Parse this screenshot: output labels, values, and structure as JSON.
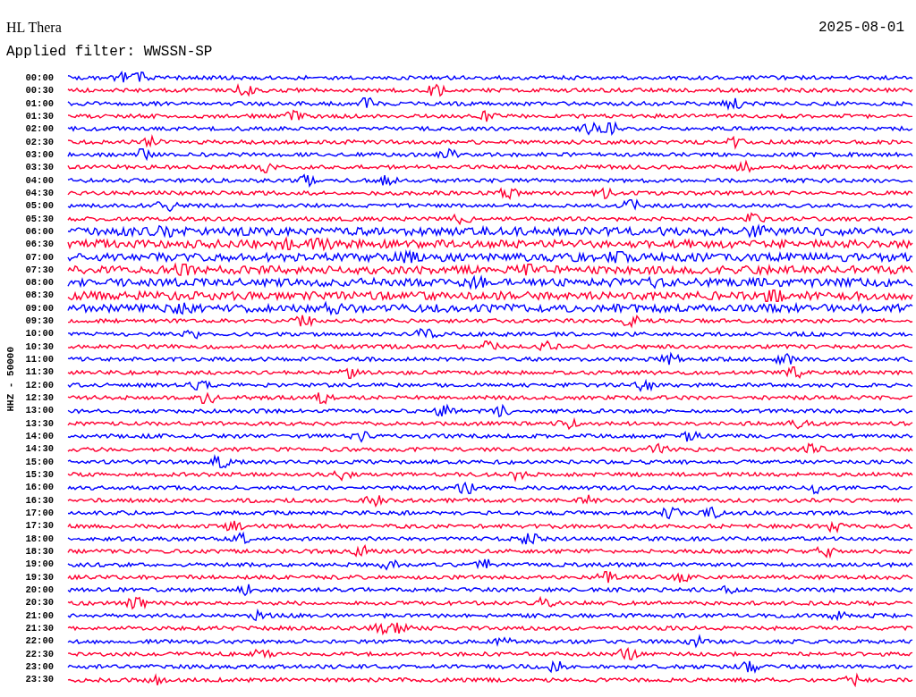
{
  "station": "HL Thera",
  "date": "2025-08-01",
  "filter": "Applied filter: WWSSN-SP",
  "channel_label": "HHZ - 50000",
  "rows": [
    {
      "time": "00:00",
      "color": "#0000ff"
    },
    {
      "time": "00:30",
      "color": "#ff0033"
    },
    {
      "time": "01:00",
      "color": "#0000ff"
    },
    {
      "time": "01:30",
      "color": "#ff0033"
    },
    {
      "time": "02:00",
      "color": "#0000ff"
    },
    {
      "time": "02:30",
      "color": "#ff0033"
    },
    {
      "time": "03:00",
      "color": "#0000ff"
    },
    {
      "time": "03:30",
      "color": "#ff0033"
    },
    {
      "time": "04:00",
      "color": "#0000ff"
    },
    {
      "time": "04:30",
      "color": "#ff0033"
    },
    {
      "time": "05:00",
      "color": "#0000ff"
    },
    {
      "time": "05:30",
      "color": "#ff0033"
    },
    {
      "time": "06:00",
      "color": "#0000ff"
    },
    {
      "time": "06:30",
      "color": "#ff0033"
    },
    {
      "time": "07:00",
      "color": "#0000ff"
    },
    {
      "time": "07:30",
      "color": "#ff0033"
    },
    {
      "time": "08:00",
      "color": "#0000ff"
    },
    {
      "time": "08:30",
      "color": "#ff0033"
    },
    {
      "time": "09:00",
      "color": "#0000ff"
    },
    {
      "time": "09:30",
      "color": "#ff0033"
    },
    {
      "time": "10:00",
      "color": "#0000ff"
    },
    {
      "time": "10:30",
      "color": "#ff0033"
    },
    {
      "time": "11:00",
      "color": "#0000ff"
    },
    {
      "time": "11:30",
      "color": "#ff0033"
    },
    {
      "time": "12:00",
      "color": "#0000ff"
    },
    {
      "time": "12:30",
      "color": "#ff0033"
    },
    {
      "time": "13:00",
      "color": "#0000ff"
    },
    {
      "time": "13:30",
      "color": "#ff0033"
    },
    {
      "time": "14:00",
      "color": "#0000ff"
    },
    {
      "time": "14:30",
      "color": "#ff0033"
    },
    {
      "time": "15:00",
      "color": "#0000ff"
    },
    {
      "time": "15:30",
      "color": "#ff0033"
    },
    {
      "time": "16:00",
      "color": "#0000ff"
    },
    {
      "time": "16:30",
      "color": "#ff0033"
    },
    {
      "time": "17:00",
      "color": "#0000ff"
    },
    {
      "time": "17:30",
      "color": "#ff0033"
    },
    {
      "time": "18:00",
      "color": "#0000ff"
    },
    {
      "time": "18:30",
      "color": "#ff0033"
    },
    {
      "time": "19:00",
      "color": "#0000ff"
    },
    {
      "time": "19:30",
      "color": "#ff0033"
    },
    {
      "time": "20:00",
      "color": "#0000ff"
    },
    {
      "time": "20:30",
      "color": "#ff0033"
    },
    {
      "time": "21:00",
      "color": "#0000ff"
    },
    {
      "time": "21:30",
      "color": "#ff0033"
    },
    {
      "time": "22:00",
      "color": "#0000ff"
    },
    {
      "time": "22:30",
      "color": "#ff0033"
    },
    {
      "time": "23:00",
      "color": "#0000ff"
    },
    {
      "time": "23:30",
      "color": "#ff0033"
    }
  ]
}
